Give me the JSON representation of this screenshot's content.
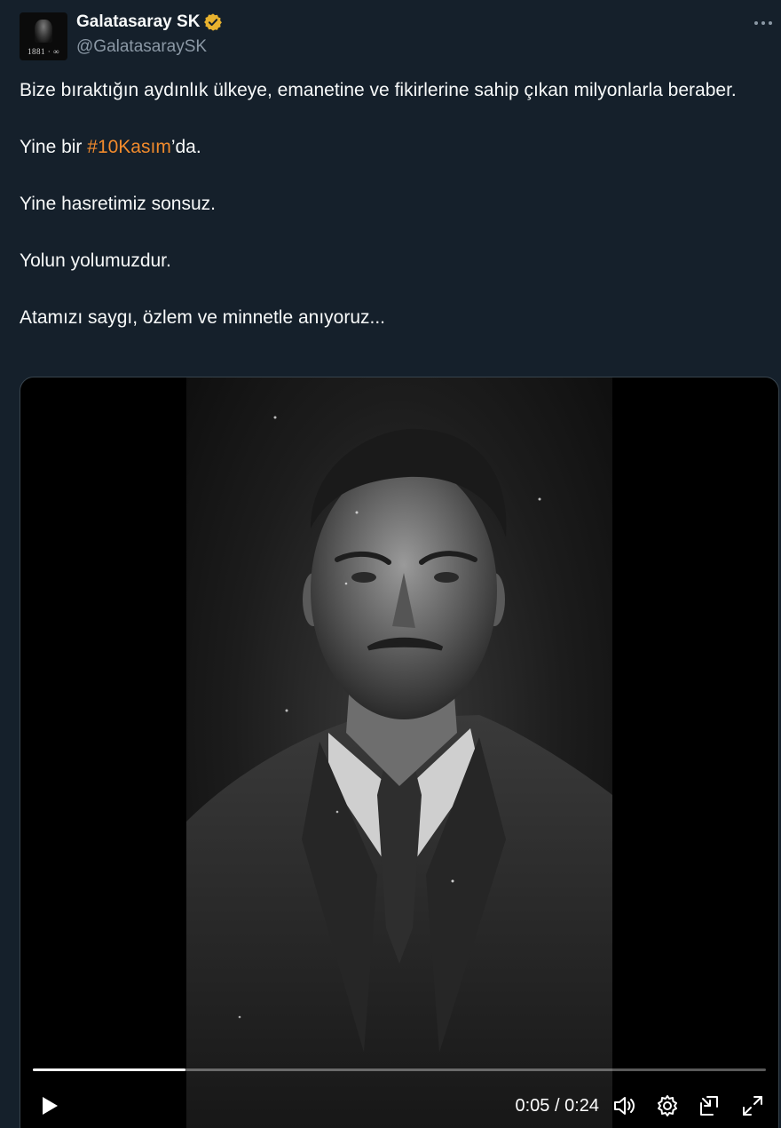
{
  "author": {
    "display_name": "Galatasaray SK",
    "handle": "@GalatasaraySK",
    "avatar_years": "1881 · ∞",
    "verified_color": "#e8b22e"
  },
  "tweet": {
    "paragraph_1": "Bize bıraktığın aydınlık ülkeye, emanetine ve fikirlerine sahip çıkan milyonlarla beraber.",
    "paragraph_2_prefix": "Yine bir ",
    "hashtag": "#10Kasım",
    "paragraph_2_suffix": "’da.",
    "paragraph_3": "Yine hasretimiz sonsuz.",
    "paragraph_4": "Yolun yolumuzdur.",
    "paragraph_5": "Atamızı saygı, özlem ve minnetle anıyoruz..."
  },
  "video": {
    "current_time": "0:05",
    "duration": "0:24",
    "time_display": "0:05 / 0:24",
    "progress_fraction": 0.208
  },
  "colors": {
    "background": "#15202b",
    "hashtag": "#f08a2c",
    "secondary_text": "#8b98a5"
  },
  "icons": {
    "more": "more-icon",
    "verified": "verified-badge-icon",
    "play": "play-icon",
    "volume": "volume-icon",
    "settings": "settings-icon",
    "pip": "picture-in-picture-icon",
    "fullscreen": "fullscreen-icon"
  }
}
